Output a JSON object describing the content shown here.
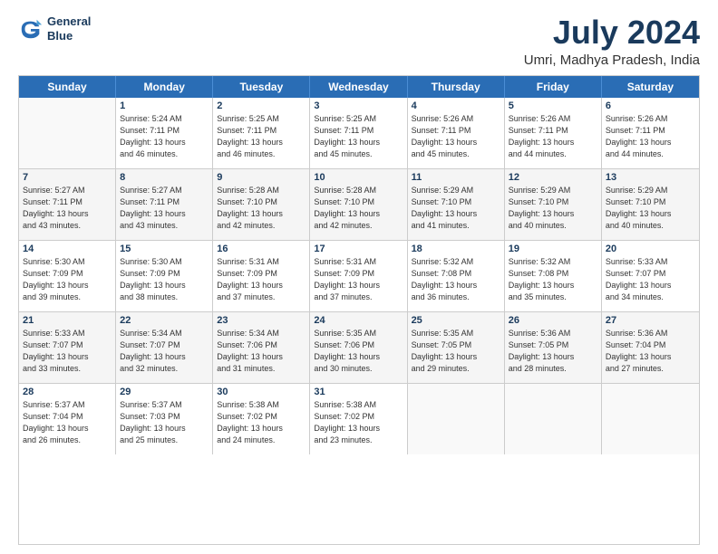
{
  "logo": {
    "line1": "General",
    "line2": "Blue"
  },
  "title": "July 2024",
  "subtitle": "Umri, Madhya Pradesh, India",
  "header_days": [
    "Sunday",
    "Monday",
    "Tuesday",
    "Wednesday",
    "Thursday",
    "Friday",
    "Saturday"
  ],
  "weeks": [
    [
      {
        "day": "",
        "info": [],
        "empty": true
      },
      {
        "day": "1",
        "info": [
          "Sunrise: 5:24 AM",
          "Sunset: 7:11 PM",
          "Daylight: 13 hours",
          "and 46 minutes."
        ]
      },
      {
        "day": "2",
        "info": [
          "Sunrise: 5:25 AM",
          "Sunset: 7:11 PM",
          "Daylight: 13 hours",
          "and 46 minutes."
        ]
      },
      {
        "day": "3",
        "info": [
          "Sunrise: 5:25 AM",
          "Sunset: 7:11 PM",
          "Daylight: 13 hours",
          "and 45 minutes."
        ]
      },
      {
        "day": "4",
        "info": [
          "Sunrise: 5:26 AM",
          "Sunset: 7:11 PM",
          "Daylight: 13 hours",
          "and 45 minutes."
        ]
      },
      {
        "day": "5",
        "info": [
          "Sunrise: 5:26 AM",
          "Sunset: 7:11 PM",
          "Daylight: 13 hours",
          "and 44 minutes."
        ]
      },
      {
        "day": "6",
        "info": [
          "Sunrise: 5:26 AM",
          "Sunset: 7:11 PM",
          "Daylight: 13 hours",
          "and 44 minutes."
        ]
      }
    ],
    [
      {
        "day": "7",
        "info": [
          "Sunrise: 5:27 AM",
          "Sunset: 7:11 PM",
          "Daylight: 13 hours",
          "and 43 minutes."
        ]
      },
      {
        "day": "8",
        "info": [
          "Sunrise: 5:27 AM",
          "Sunset: 7:11 PM",
          "Daylight: 13 hours",
          "and 43 minutes."
        ]
      },
      {
        "day": "9",
        "info": [
          "Sunrise: 5:28 AM",
          "Sunset: 7:10 PM",
          "Daylight: 13 hours",
          "and 42 minutes."
        ]
      },
      {
        "day": "10",
        "info": [
          "Sunrise: 5:28 AM",
          "Sunset: 7:10 PM",
          "Daylight: 13 hours",
          "and 42 minutes."
        ]
      },
      {
        "day": "11",
        "info": [
          "Sunrise: 5:29 AM",
          "Sunset: 7:10 PM",
          "Daylight: 13 hours",
          "and 41 minutes."
        ]
      },
      {
        "day": "12",
        "info": [
          "Sunrise: 5:29 AM",
          "Sunset: 7:10 PM",
          "Daylight: 13 hours",
          "and 40 minutes."
        ]
      },
      {
        "day": "13",
        "info": [
          "Sunrise: 5:29 AM",
          "Sunset: 7:10 PM",
          "Daylight: 13 hours",
          "and 40 minutes."
        ]
      }
    ],
    [
      {
        "day": "14",
        "info": [
          "Sunrise: 5:30 AM",
          "Sunset: 7:09 PM",
          "Daylight: 13 hours",
          "and 39 minutes."
        ]
      },
      {
        "day": "15",
        "info": [
          "Sunrise: 5:30 AM",
          "Sunset: 7:09 PM",
          "Daylight: 13 hours",
          "and 38 minutes."
        ]
      },
      {
        "day": "16",
        "info": [
          "Sunrise: 5:31 AM",
          "Sunset: 7:09 PM",
          "Daylight: 13 hours",
          "and 37 minutes."
        ]
      },
      {
        "day": "17",
        "info": [
          "Sunrise: 5:31 AM",
          "Sunset: 7:09 PM",
          "Daylight: 13 hours",
          "and 37 minutes."
        ]
      },
      {
        "day": "18",
        "info": [
          "Sunrise: 5:32 AM",
          "Sunset: 7:08 PM",
          "Daylight: 13 hours",
          "and 36 minutes."
        ]
      },
      {
        "day": "19",
        "info": [
          "Sunrise: 5:32 AM",
          "Sunset: 7:08 PM",
          "Daylight: 13 hours",
          "and 35 minutes."
        ]
      },
      {
        "day": "20",
        "info": [
          "Sunrise: 5:33 AM",
          "Sunset: 7:07 PM",
          "Daylight: 13 hours",
          "and 34 minutes."
        ]
      }
    ],
    [
      {
        "day": "21",
        "info": [
          "Sunrise: 5:33 AM",
          "Sunset: 7:07 PM",
          "Daylight: 13 hours",
          "and 33 minutes."
        ]
      },
      {
        "day": "22",
        "info": [
          "Sunrise: 5:34 AM",
          "Sunset: 7:07 PM",
          "Daylight: 13 hours",
          "and 32 minutes."
        ]
      },
      {
        "day": "23",
        "info": [
          "Sunrise: 5:34 AM",
          "Sunset: 7:06 PM",
          "Daylight: 13 hours",
          "and 31 minutes."
        ]
      },
      {
        "day": "24",
        "info": [
          "Sunrise: 5:35 AM",
          "Sunset: 7:06 PM",
          "Daylight: 13 hours",
          "and 30 minutes."
        ]
      },
      {
        "day": "25",
        "info": [
          "Sunrise: 5:35 AM",
          "Sunset: 7:05 PM",
          "Daylight: 13 hours",
          "and 29 minutes."
        ]
      },
      {
        "day": "26",
        "info": [
          "Sunrise: 5:36 AM",
          "Sunset: 7:05 PM",
          "Daylight: 13 hours",
          "and 28 minutes."
        ]
      },
      {
        "day": "27",
        "info": [
          "Sunrise: 5:36 AM",
          "Sunset: 7:04 PM",
          "Daylight: 13 hours",
          "and 27 minutes."
        ]
      }
    ],
    [
      {
        "day": "28",
        "info": [
          "Sunrise: 5:37 AM",
          "Sunset: 7:04 PM",
          "Daylight: 13 hours",
          "and 26 minutes."
        ]
      },
      {
        "day": "29",
        "info": [
          "Sunrise: 5:37 AM",
          "Sunset: 7:03 PM",
          "Daylight: 13 hours",
          "and 25 minutes."
        ]
      },
      {
        "day": "30",
        "info": [
          "Sunrise: 5:38 AM",
          "Sunset: 7:02 PM",
          "Daylight: 13 hours",
          "and 24 minutes."
        ]
      },
      {
        "day": "31",
        "info": [
          "Sunrise: 5:38 AM",
          "Sunset: 7:02 PM",
          "Daylight: 13 hours",
          "and 23 minutes."
        ]
      },
      {
        "day": "",
        "info": [],
        "empty": true
      },
      {
        "day": "",
        "info": [],
        "empty": true
      },
      {
        "day": "",
        "info": [],
        "empty": true
      }
    ]
  ]
}
